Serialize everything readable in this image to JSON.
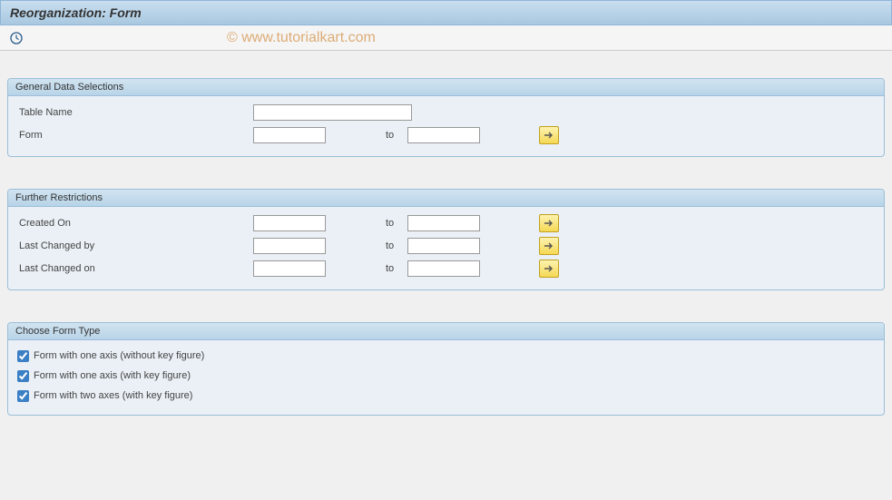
{
  "title": "Reorganization: Form",
  "watermark": "© www.tutorialkart.com",
  "groups": {
    "general": {
      "header": "General Data Selections",
      "table_name_label": "Table Name",
      "form_label": "Form",
      "to_label": "to"
    },
    "further": {
      "header": "Further Restrictions",
      "created_on_label": "Created On",
      "last_changed_by_label": "Last Changed by",
      "last_changed_on_label": "Last Changed on",
      "to_label": "to"
    },
    "formtype": {
      "header": "Choose Form Type",
      "opt1": "Form with one axis (without key figure)",
      "opt2": "Form with one axis (with key figure)",
      "opt3": "Form with two axes (with key figure)"
    }
  },
  "icons": {
    "clock": "clock-icon",
    "arrow_right": "arrow-right-icon"
  },
  "values": {
    "table_name": "",
    "form_from": "",
    "form_to": "",
    "created_on_from": "",
    "created_on_to": "",
    "last_changed_by_from": "",
    "last_changed_by_to": "",
    "last_changed_on_from": "",
    "last_changed_on_to": "",
    "opt1_checked": true,
    "opt2_checked": true,
    "opt3_checked": true
  }
}
